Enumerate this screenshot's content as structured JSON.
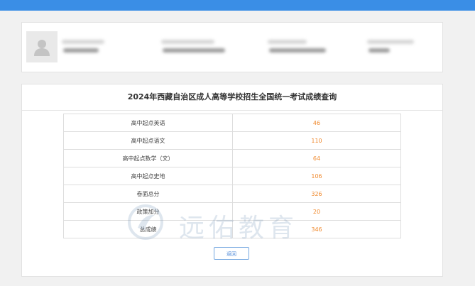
{
  "result": {
    "title": "2024年西藏自治区成人高等学校招生全国统一考试成绩查询",
    "rows": [
      {
        "label": "高中起点英语",
        "value": "46"
      },
      {
        "label": "高中起点语文",
        "value": "110"
      },
      {
        "label": "高中起点数学（文）",
        "value": "64"
      },
      {
        "label": "高中起点史地",
        "value": "106"
      },
      {
        "label": "卷面总分",
        "value": "326"
      },
      {
        "label": "政策加分",
        "value": "20"
      },
      {
        "label": "总成绩",
        "value": "346"
      }
    ],
    "back_label": "返回"
  },
  "watermark": {
    "text": "远佑教育"
  },
  "colors": {
    "accent": "#3a8ee6",
    "score": "#f08a2e"
  },
  "icons": {
    "avatar": "user-icon"
  }
}
